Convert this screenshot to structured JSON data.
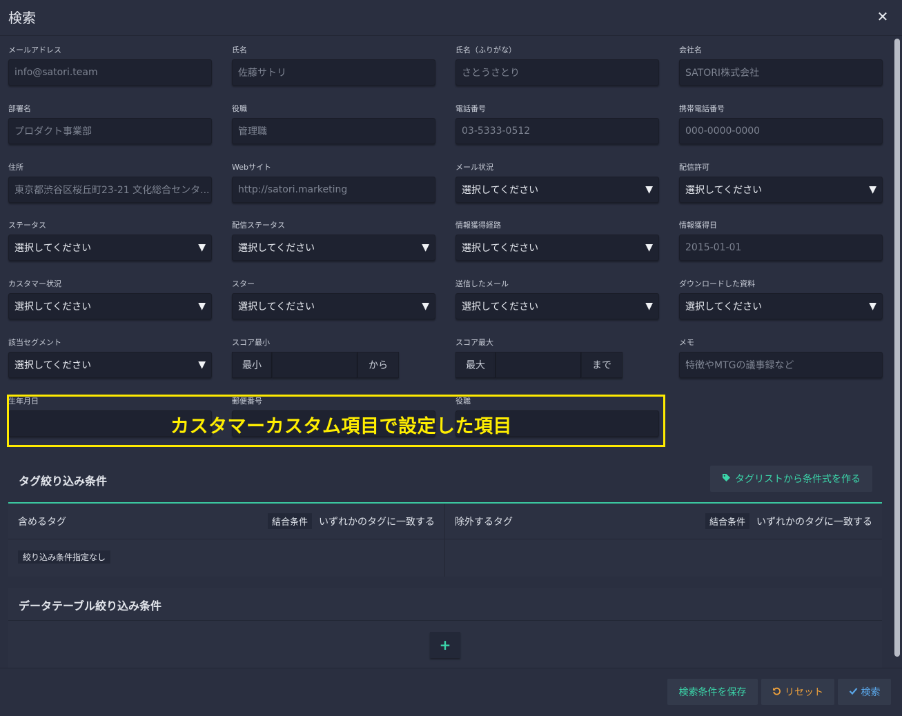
{
  "modal": {
    "title": "検索",
    "close_glyph": "✕"
  },
  "fields": {
    "email": {
      "label": "メールアドレス",
      "placeholder": "info@satori.team"
    },
    "name": {
      "label": "氏名",
      "placeholder": "佐藤サトリ"
    },
    "name_kana": {
      "label": "氏名（ふりがな）",
      "placeholder": "さとうさとり"
    },
    "company": {
      "label": "会社名",
      "placeholder": "SATORI株式会社"
    },
    "department": {
      "label": "部署名",
      "placeholder": "プロダクト事業部"
    },
    "position": {
      "label": "役職",
      "placeholder": "管理職"
    },
    "phone": {
      "label": "電話番号",
      "placeholder": "03-5333-0512"
    },
    "mobile": {
      "label": "携帯電話番号",
      "placeholder": "000-0000-0000"
    },
    "address": {
      "label": "住所",
      "placeholder": "東京都渋谷区桜丘町23-21 文化総合センタ..."
    },
    "website": {
      "label": "Webサイト",
      "placeholder": "http://satori.marketing"
    },
    "mail_status": {
      "label": "メール状況",
      "value": "選択してください"
    },
    "delivery_permission": {
      "label": "配信許可",
      "value": "選択してください"
    },
    "status": {
      "label": "ステータス",
      "value": "選択してください"
    },
    "delivery_status": {
      "label": "配信ステータス",
      "value": "選択してください"
    },
    "acquisition_route": {
      "label": "情報獲得経路",
      "value": "選択してください"
    },
    "acquisition_date": {
      "label": "情報獲得日",
      "placeholder": "2015-01-01"
    },
    "customer_status": {
      "label": "カスタマー状況",
      "value": "選択してください"
    },
    "star": {
      "label": "スター",
      "value": "選択してください"
    },
    "sent_mail": {
      "label": "送信したメール",
      "value": "選択してください"
    },
    "downloaded": {
      "label": "ダウンロードした資料",
      "value": "選択してください"
    },
    "segment": {
      "label": "該当セグメント",
      "value": "選択してください"
    },
    "score_min": {
      "label": "スコア最小",
      "prefix": "最小",
      "suffix": "から"
    },
    "score_max": {
      "label": "スコア最大",
      "prefix": "最大",
      "suffix": "まで"
    },
    "memo": {
      "label": "メモ",
      "placeholder": "特徴やMTGの議事録など"
    },
    "birthday": {
      "label": "生年月日"
    },
    "postal": {
      "label": "郵便番号"
    },
    "position2": {
      "label": "役職"
    }
  },
  "select_caret": "▼",
  "annotation": {
    "text": "カスタマーカスタム項目で設定した項目",
    "color": "#ffee00"
  },
  "tags": {
    "title": "タグ絞り込み条件",
    "create_button": "タグリストから条件式を作る",
    "include_label": "含めるタグ",
    "exclude_label": "除外するタグ",
    "join_label": "結合条件",
    "join_value": "いずれかのタグに一致する",
    "no_filter": "絞り込み条件指定なし"
  },
  "datatable": {
    "title": "データテーブル絞り込み条件",
    "add_glyph": "+"
  },
  "footer": {
    "save": "検索条件を保存",
    "reset": "リセット",
    "search": "検索"
  },
  "colors": {
    "accent": "#3bd5a9",
    "reset": "#f0a23c",
    "search": "#5aa6e8",
    "background": "#2a2f40"
  },
  "icons": {
    "tag": "tag-icon",
    "reset": "undo-icon",
    "search": "check-icon"
  }
}
